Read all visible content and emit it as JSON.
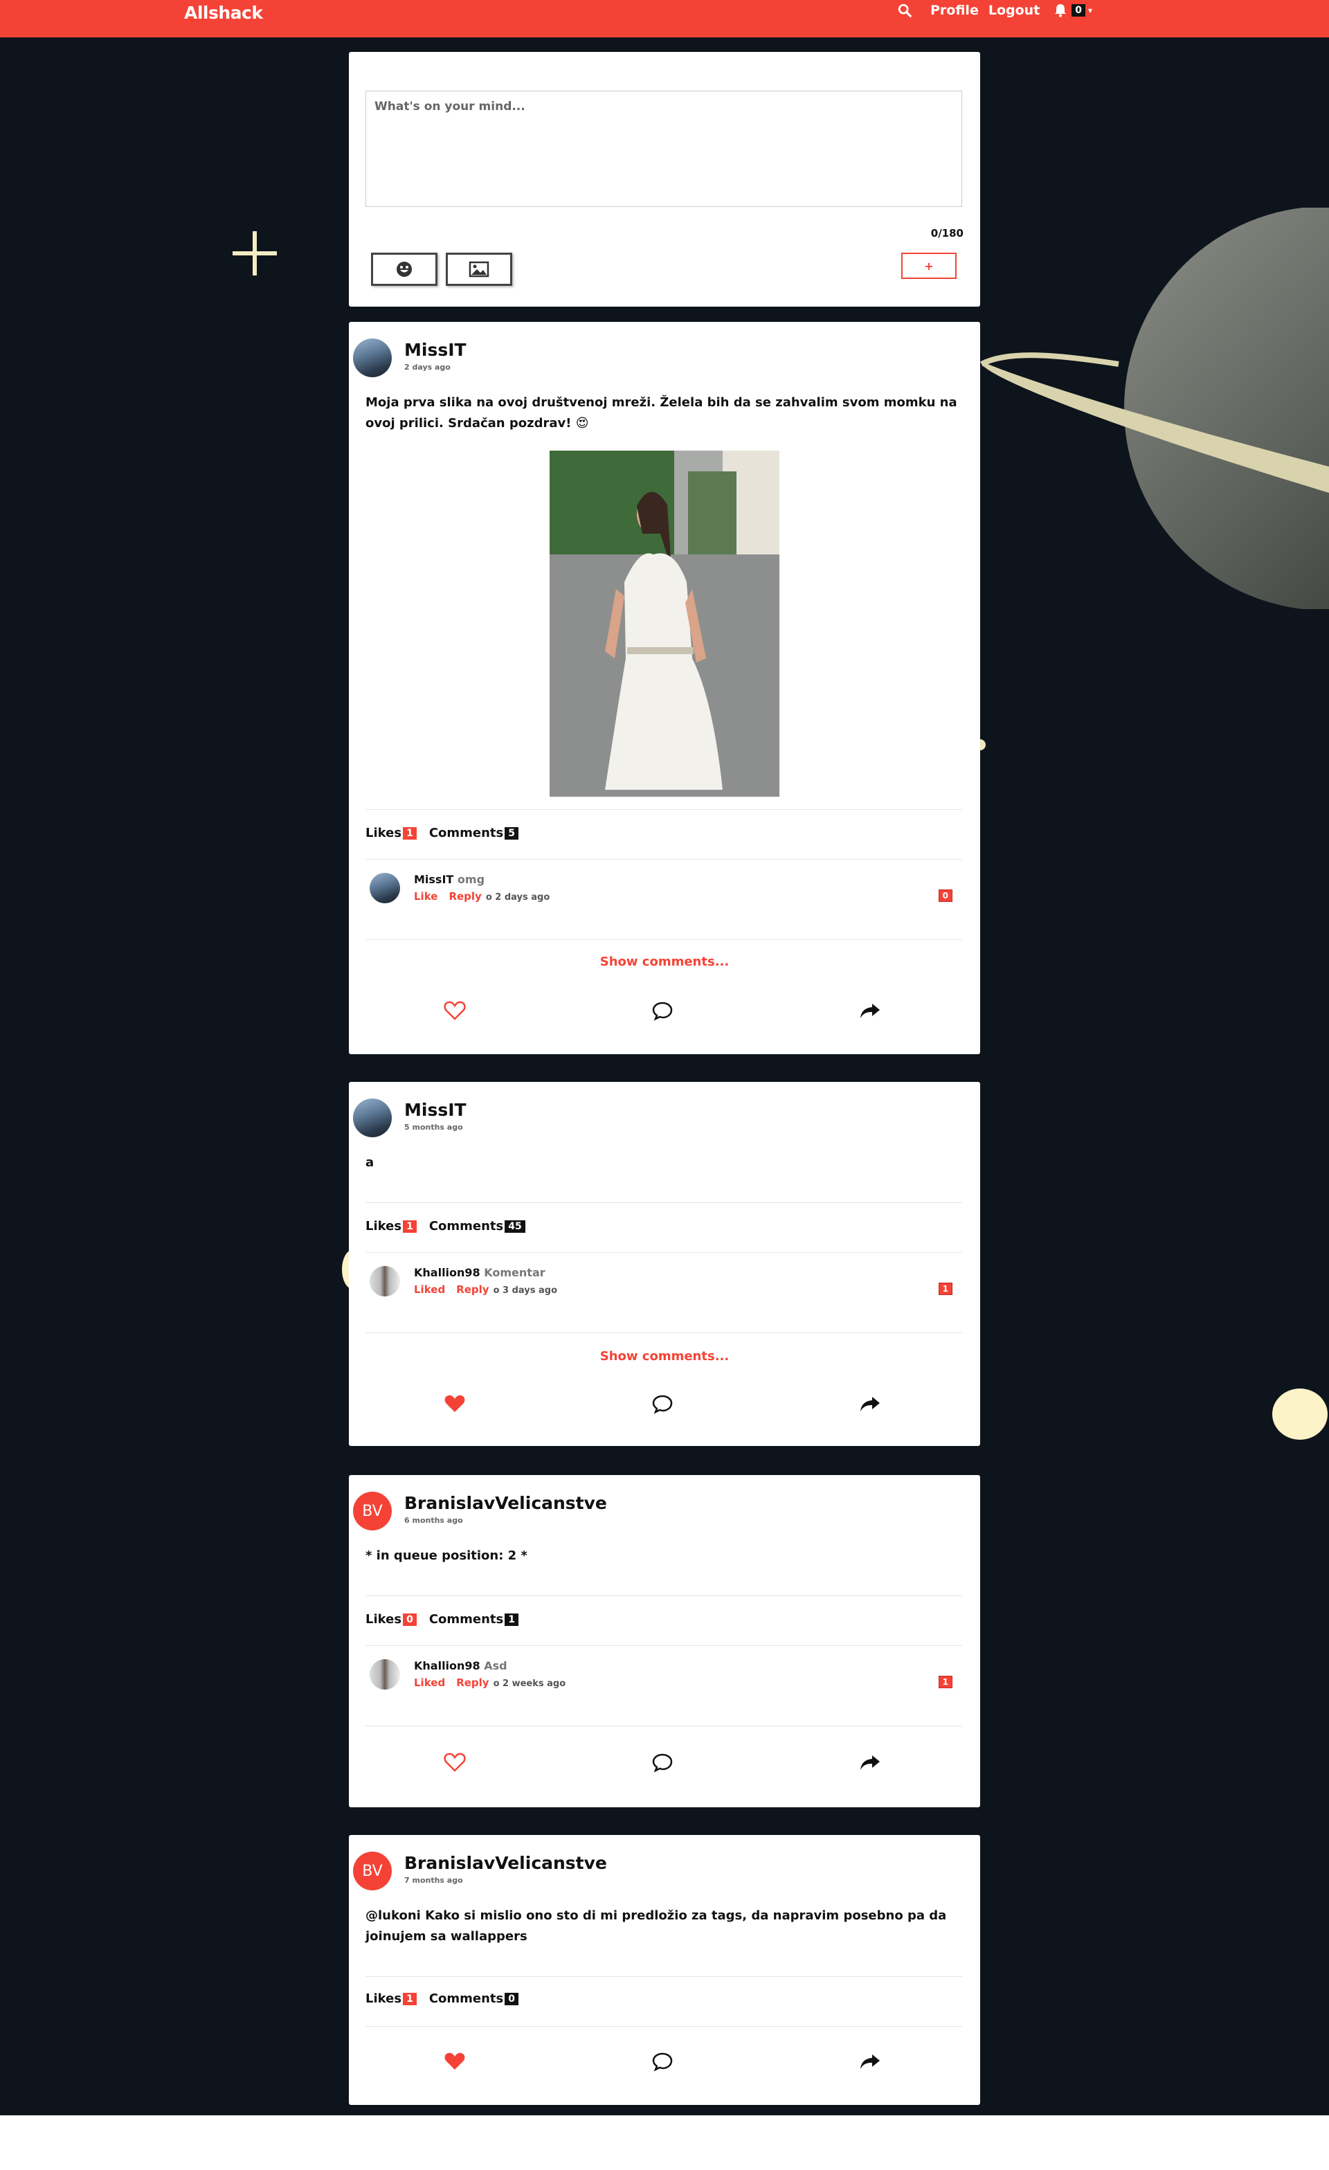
{
  "nav": {
    "brand": "Allshack",
    "profile": "Profile",
    "logout": "Logout",
    "notif_count": "0"
  },
  "icons": [
    "search-icon",
    "bell-icon",
    "caret-down-icon",
    "smile-icon",
    "image-icon",
    "heart-icon",
    "comment-icon",
    "share-icon"
  ],
  "colors": {
    "accent": "#f44336",
    "background": "#0d141b",
    "card": "#ffffff"
  },
  "composer": {
    "placeholder": "What's on your mind...",
    "char_count": "0/180",
    "add_label": "+"
  },
  "posts": [
    {
      "author": "MissIT",
      "time": "2 days ago",
      "text": "Moja prva slika na ovoj društvenoj mreži. Želela bih da se zahvalim svom momku na ovoj prilici. Srdačan pozdrav! 😍",
      "likes_label": "Likes",
      "likes": "1",
      "comments_label": "Comments",
      "comments": "5",
      "liked": false,
      "comment": {
        "user": "MissIT",
        "text": "omg",
        "like_label": "Like",
        "reply_label": "Reply",
        "time": "o 2 days ago",
        "count": "0"
      },
      "show_comments": "Show comments..."
    },
    {
      "author": "MissIT",
      "time": "5 months ago",
      "text": "a",
      "likes_label": "Likes",
      "likes": "1",
      "comments_label": "Comments",
      "comments": "45",
      "liked": true,
      "comment": {
        "user": "Khallion98",
        "text": "Komentar",
        "like_label": "Liked",
        "reply_label": "Reply",
        "time": "o 3 days ago",
        "count": "1"
      },
      "show_comments": "Show comments..."
    },
    {
      "author": "BranislavVelicanstve",
      "initials": "BV",
      "time": "6 months ago",
      "text": "* in queue position: 2 *",
      "likes_label": "Likes",
      "likes": "0",
      "comments_label": "Comments",
      "comments": "1",
      "liked": false,
      "comment": {
        "user": "Khallion98",
        "text": "Asd",
        "like_label": "Liked",
        "reply_label": "Reply",
        "time": "o 2 weeks ago",
        "count": "1"
      }
    },
    {
      "author": "BranislavVelicanstve",
      "initials": "BV",
      "time": "7 months ago",
      "text": "@lukoni Kako si mislio ono sto di mi predložio za tags, da napravim posebno pa da joinujem sa wallappers",
      "likes_label": "Likes",
      "likes": "1",
      "comments_label": "Comments",
      "comments": "0",
      "liked": true
    }
  ]
}
